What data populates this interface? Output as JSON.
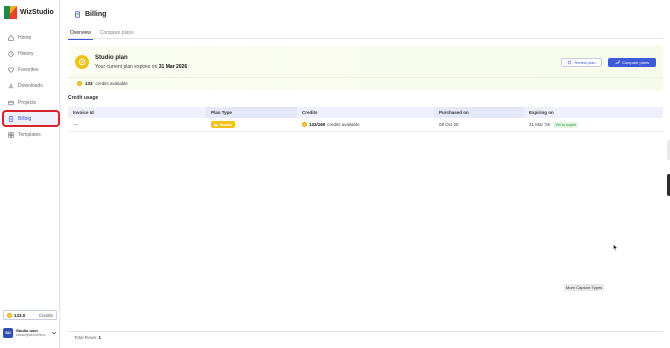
{
  "app": {
    "name": "WizStudio"
  },
  "sidebar": {
    "items": [
      {
        "label": "Home",
        "icon": "home-icon"
      },
      {
        "label": "History",
        "icon": "history-icon"
      },
      {
        "label": "Favorites",
        "icon": "heart-icon"
      },
      {
        "label": "Downloads",
        "icon": "download-icon"
      },
      {
        "label": "Projects",
        "icon": "projects-icon"
      },
      {
        "label": "Billing",
        "icon": "billing-icon",
        "active": true
      },
      {
        "label": "Templates",
        "icon": "templates-icon"
      }
    ],
    "credits": {
      "value": "133.0",
      "label": "Credits"
    },
    "user": {
      "initials": "SU",
      "name": "Studio user",
      "email": "studio@wizcommo..."
    }
  },
  "page": {
    "title": "Billing",
    "tabs": [
      {
        "label": "Overview",
        "active": true
      },
      {
        "label": "Compare plans",
        "active": false
      }
    ]
  },
  "plan": {
    "title": "Studio plan",
    "expiry_prefix": "Your current plan expires on",
    "expiry_date": "31 Mar 2026",
    "renew_label": "Renew plan",
    "compare_label": "Compare plans",
    "credits_value": "133",
    "credits_suffix": "credits available"
  },
  "credit_usage": {
    "title": "Credit usage",
    "columns": [
      "Invoice Id",
      "Plan Type",
      "Credits",
      "Purchased on",
      "Expiring on"
    ],
    "rows": [
      {
        "invoice_id": "—",
        "plan_type": "Studio",
        "credits": "133/160",
        "credits_suffix": "credits available",
        "purchased_on": "08 Oct 25",
        "expiring_on": "31 Mar '26",
        "status": "Yet to expire"
      }
    ]
  },
  "footer": {
    "total_rows_label": "Total Rows:",
    "total_rows_value": "1"
  },
  "tooltip": {
    "text": "More Capture Types"
  },
  "colors": {
    "accent": "#3d5bd9",
    "gold": "#f2c21b",
    "active_outline": "#d9232d",
    "success": "#2e8b3a"
  }
}
